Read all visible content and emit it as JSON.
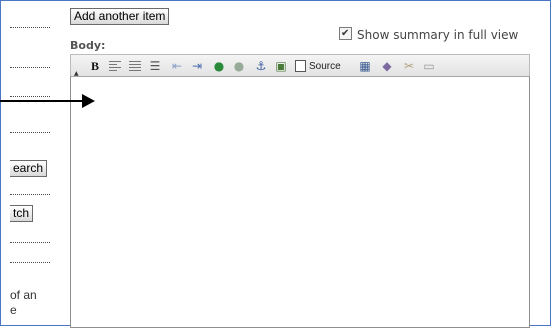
{
  "form": {
    "add_item_label": "Add another item",
    "body_label": "Body:",
    "summary_toggle_label": "Show summary in full view",
    "summary_checked": true
  },
  "toolbar": {
    "bold_label": "B",
    "source_label": "Source",
    "icons": [
      "bold-icon",
      "align-left-icon",
      "justify-icon",
      "bulleted-list-icon",
      "outdent-icon",
      "indent-icon",
      "link-icon",
      "unlink-icon",
      "anchor-icon",
      "image-icon",
      "source-icon",
      "paste-word-icon",
      "special-char-icon",
      "cut-icon",
      "horizontal-rule-icon"
    ]
  },
  "sidebar": {
    "search_button_fragment": "earch",
    "match_button_fragment": "tch",
    "description_fragment_1": "of an",
    "description_fragment_2": "e"
  }
}
